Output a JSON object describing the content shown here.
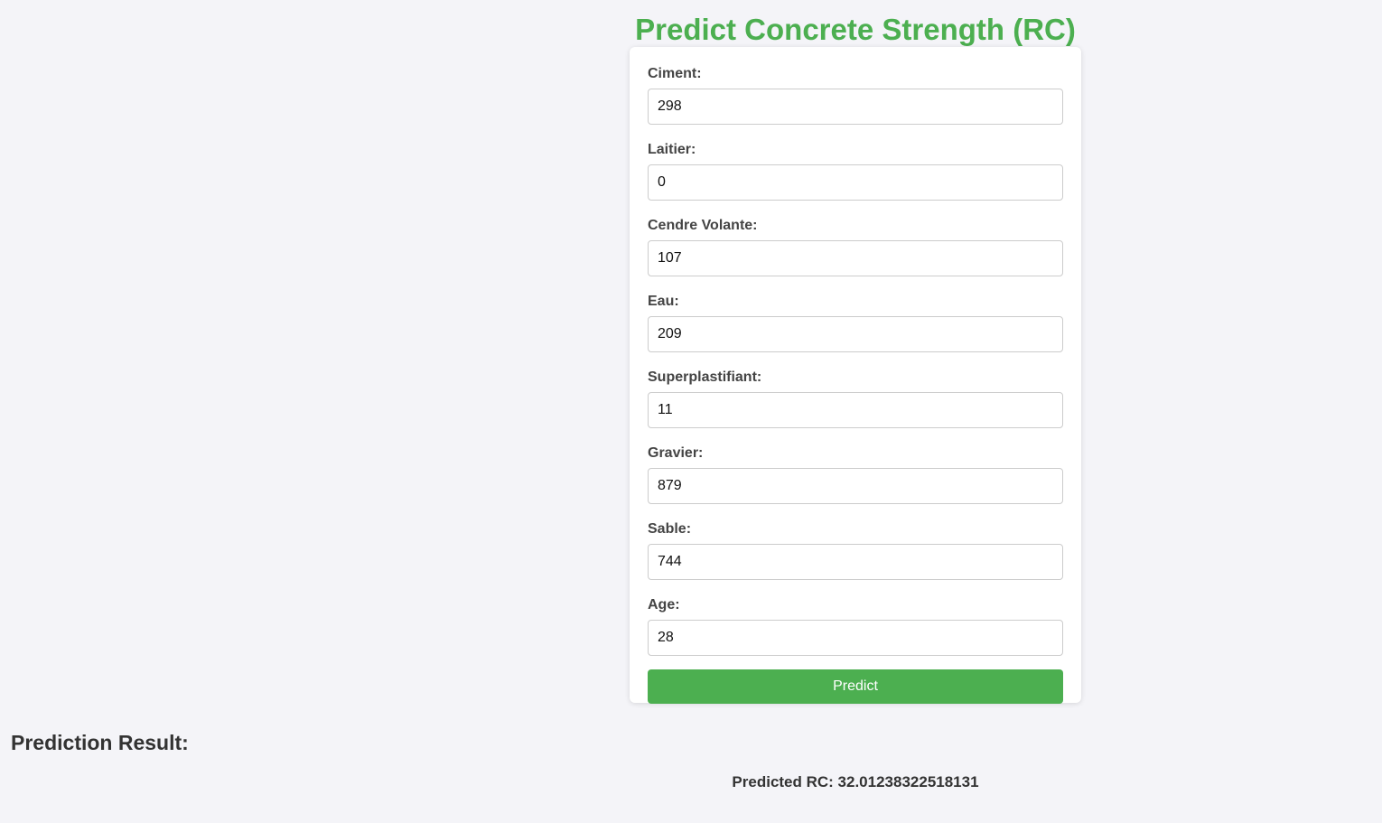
{
  "page": {
    "title": "Predict Concrete Strength (RC)"
  },
  "form": {
    "fields": [
      {
        "label": "Ciment:",
        "value": "298"
      },
      {
        "label": "Laitier:",
        "value": "0"
      },
      {
        "label": "Cendre Volante:",
        "value": "107"
      },
      {
        "label": "Eau:",
        "value": "209"
      },
      {
        "label": "Superplastifiant:",
        "value": "11"
      },
      {
        "label": "Gravier:",
        "value": "879"
      },
      {
        "label": "Sable:",
        "value": "744"
      },
      {
        "label": "Age:",
        "value": "28"
      }
    ],
    "submit_label": "Predict"
  },
  "result": {
    "heading": "Prediction Result:",
    "text": "Predicted RC: 32.01238322518131"
  },
  "colors": {
    "accent": "#4caf50",
    "background": "#f4f4f8",
    "card": "#ffffff"
  }
}
